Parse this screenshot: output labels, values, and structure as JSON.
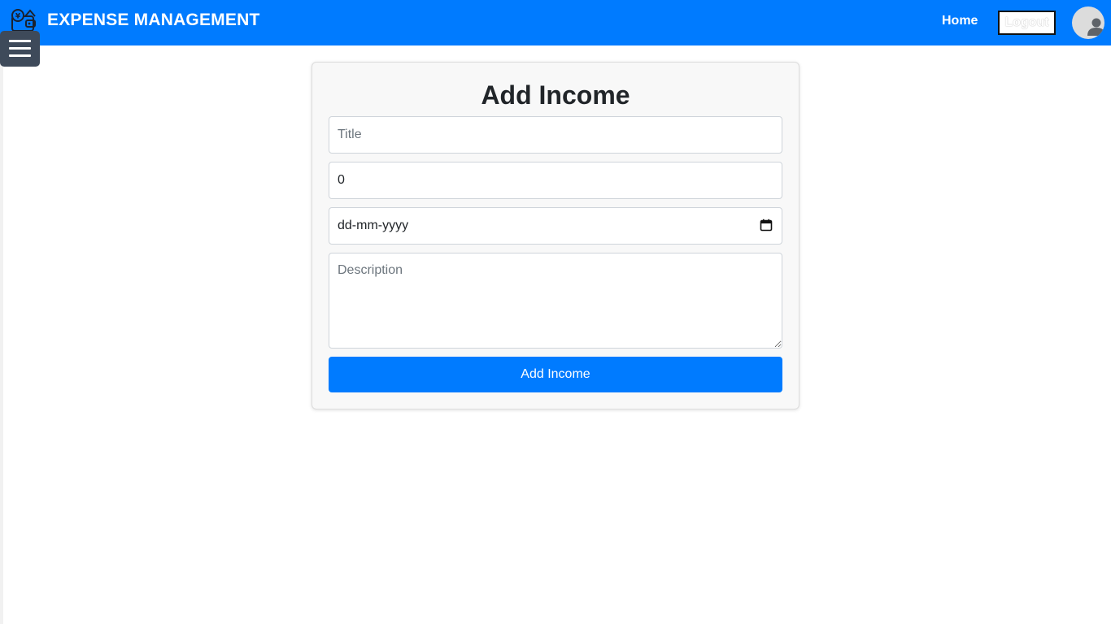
{
  "navbar": {
    "brand_title": "EXPENSE MANAGEMENT",
    "brand_icon": "wallet-icon",
    "home_label": "Home",
    "logout_label": "Logout",
    "avatar_icon": "user-avatar-icon",
    "bg_color": "#007bff"
  },
  "sidebar_toggle": {
    "icon": "hamburger-menu-icon"
  },
  "form": {
    "title": "Add Income",
    "title_field": {
      "placeholder": "Title",
      "value": ""
    },
    "amount_field": {
      "value": "0"
    },
    "date_field": {
      "placeholder": "dd-mm-yyyy",
      "icon": "calendar-icon"
    },
    "description_field": {
      "placeholder": "Description",
      "value": ""
    },
    "submit_label": "Add Income",
    "accent_color": "#007bff"
  }
}
